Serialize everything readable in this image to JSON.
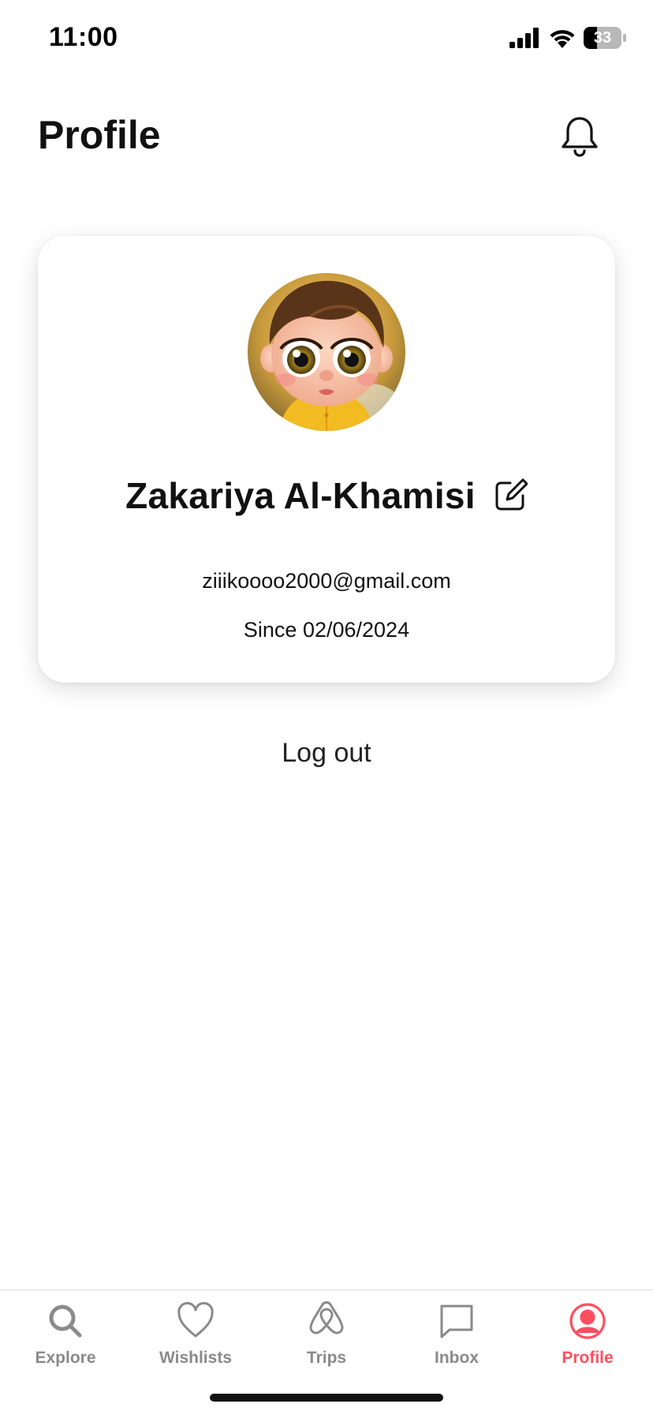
{
  "status_bar": {
    "time": "11:00",
    "battery": "33",
    "icons": [
      "signal-icon",
      "wifi-icon",
      "battery-icon"
    ]
  },
  "header": {
    "title": "Profile",
    "notification_icon": "bell-icon"
  },
  "profile": {
    "name": "Zakariya Al-Khamisi",
    "email": "ziiikoooo2000@gmail.com",
    "member_since": "Since 02/06/2024",
    "edit_icon": "edit-icon",
    "avatar": "cartoon-baby-avatar"
  },
  "actions": {
    "logout_label": "Log out"
  },
  "tabs": [
    {
      "label": "Explore",
      "icon": "search-icon",
      "active": false
    },
    {
      "label": "Wishlists",
      "icon": "heart-icon",
      "active": false
    },
    {
      "label": "Trips",
      "icon": "airbnb-logo-icon",
      "active": false
    },
    {
      "label": "Inbox",
      "icon": "chat-bubble-icon",
      "active": false
    },
    {
      "label": "Profile",
      "icon": "user-circle-icon",
      "active": true
    }
  ],
  "colors": {
    "accent": "#ff4f5f",
    "inactive_tab": "#8a8a8a",
    "text": "#111111"
  }
}
